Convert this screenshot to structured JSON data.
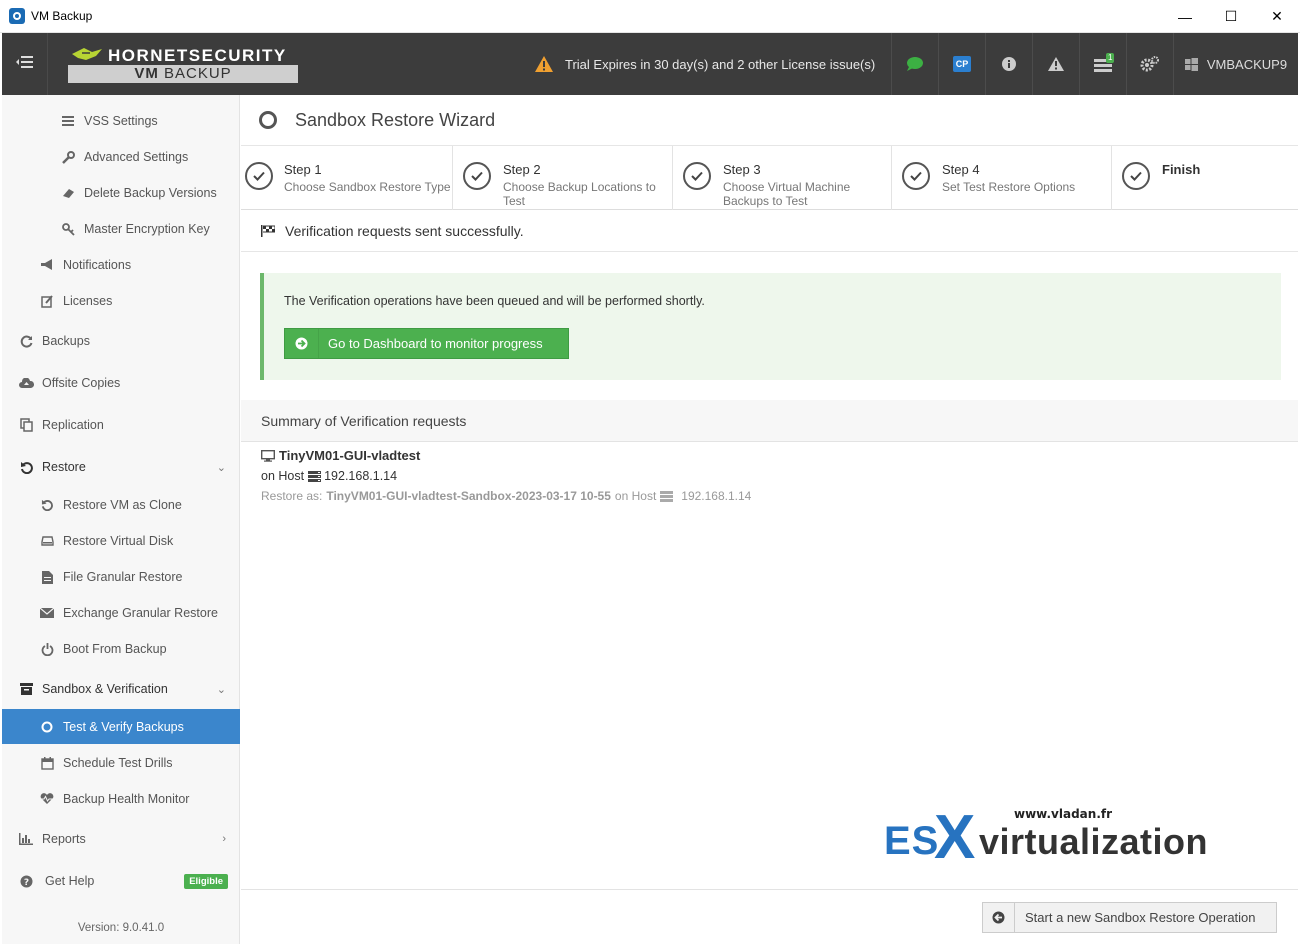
{
  "window": {
    "title": "VM Backup",
    "minimize": "—",
    "maximize": "☐",
    "close": "✕"
  },
  "header": {
    "menu_icon": "☰",
    "brand": "HORNETSECURITY",
    "product_bold": "VM",
    "product_rest": "BACKUP",
    "trial_text": "Trial Expires in 30 day(s) and 2 other License issue(s)",
    "cp_label": "CP",
    "jobs_badge": "1",
    "username": "VMBACKUP9"
  },
  "sidebar": {
    "items": [
      {
        "label": "VSS Settings",
        "icon": "list-icon"
      },
      {
        "label": "Advanced Settings",
        "icon": "wrench-icon"
      },
      {
        "label": "Delete Backup Versions",
        "icon": "eraser-icon"
      },
      {
        "label": "Master Encryption Key",
        "icon": "key-icon"
      },
      {
        "label": "Notifications",
        "icon": "bullhorn-icon"
      },
      {
        "label": "Licenses",
        "icon": "edit-icon"
      },
      {
        "label": "Backups",
        "icon": "refresh-icon"
      },
      {
        "label": "Offsite Copies",
        "icon": "cloud-upload-icon"
      },
      {
        "label": "Replication",
        "icon": "copy-icon"
      },
      {
        "label": "Restore",
        "icon": "undo-icon"
      },
      {
        "label": "Restore VM as Clone",
        "icon": "undo-icon"
      },
      {
        "label": "Restore Virtual Disk",
        "icon": "hdd-icon"
      },
      {
        "label": "File Granular Restore",
        "icon": "file-icon"
      },
      {
        "label": "Exchange Granular Restore",
        "icon": "envelope-icon"
      },
      {
        "label": "Boot From Backup",
        "icon": "power-icon"
      },
      {
        "label": "Sandbox & Verification",
        "icon": "archive-icon"
      },
      {
        "label": "Test & Verify Backups",
        "icon": "circle-icon"
      },
      {
        "label": "Schedule Test Drills",
        "icon": "calendar-icon"
      },
      {
        "label": "Backup Health Monitor",
        "icon": "heartbeat-icon"
      },
      {
        "label": "Reports",
        "icon": "bar-chart-icon"
      },
      {
        "label": "Get Help",
        "icon": "question-icon"
      }
    ],
    "badge_eligible": "Eligible",
    "version": "Version: 9.0.41.0"
  },
  "wizard": {
    "title": "Sandbox Restore Wizard",
    "steps": [
      {
        "name": "Step 1",
        "desc": "Choose Sandbox Restore Type"
      },
      {
        "name": "Step 2",
        "desc": "Choose Backup Locations to Test"
      },
      {
        "name": "Step 3",
        "desc": "Choose Virtual Machine Backups to Test"
      },
      {
        "name": "Step 4",
        "desc": "Set Test Restore Options"
      },
      {
        "name": "Finish",
        "desc": ""
      }
    ],
    "status": "Verification requests sent successfully.",
    "alert_msg": "The Verification operations have been queued and will be performed shortly.",
    "dashboard_button": "Go to Dashboard to monitor progress",
    "summary_title": "Summary of Verification requests",
    "vm": {
      "name": "TinyVM01-GUI-vladtest",
      "on_host_label": "on Host",
      "host": "192.168.1.14",
      "restore_as_label": "Restore as:",
      "restore_name": "TinyVM01-GUI-vladtest-Sandbox-2023-03-17 10-55",
      "restore_on_host_label": "on Host",
      "restore_host": "192.168.1.14"
    },
    "new_operation_button": "Start a new Sandbox Restore Operation"
  },
  "watermark": {
    "url": "www.vladan.fr",
    "es": "ES",
    "x": "X",
    "rest": "virtualization"
  },
  "colors": {
    "header_bg": "#3c3c3c",
    "active_item": "#3b86cc",
    "success_green": "#4cb04f",
    "alert_bg": "#eef7ec",
    "watermark_blue": "#2773c0"
  }
}
